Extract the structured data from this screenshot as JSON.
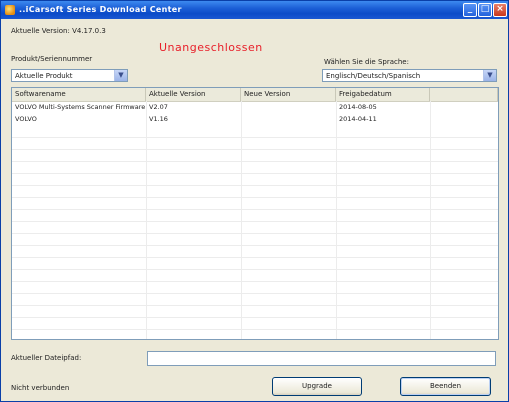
{
  "window": {
    "title": "..iCarsoft Series Download Center"
  },
  "header": {
    "version_label": "Aktuelle Version: V4.17.0.3",
    "status": "Unangeschlossen",
    "product_label": "Produkt/Seriennummer",
    "product_value": "Aktuelle Produkt",
    "language_label": "Wählen Sie die Sprache:",
    "language_value": "Englisch/Deutsch/Spanisch"
  },
  "table": {
    "columns": [
      "Softwarename",
      "Aktuelle Version",
      "Neue Version",
      "Freigabedatum",
      ""
    ],
    "rows": [
      [
        "VOLVO Multi-Systems Scanner Firmware",
        "V2.07",
        "",
        "2014-08-05",
        ""
      ],
      [
        "VOLVO",
        "V1.16",
        "",
        "2014-04-11",
        ""
      ]
    ]
  },
  "footer": {
    "path_label": "Aktueller Dateipfad:",
    "path_value": "",
    "status_label": "Nicht verbunden",
    "upgrade_label": "Upgrade",
    "close_label": "Beenden"
  }
}
